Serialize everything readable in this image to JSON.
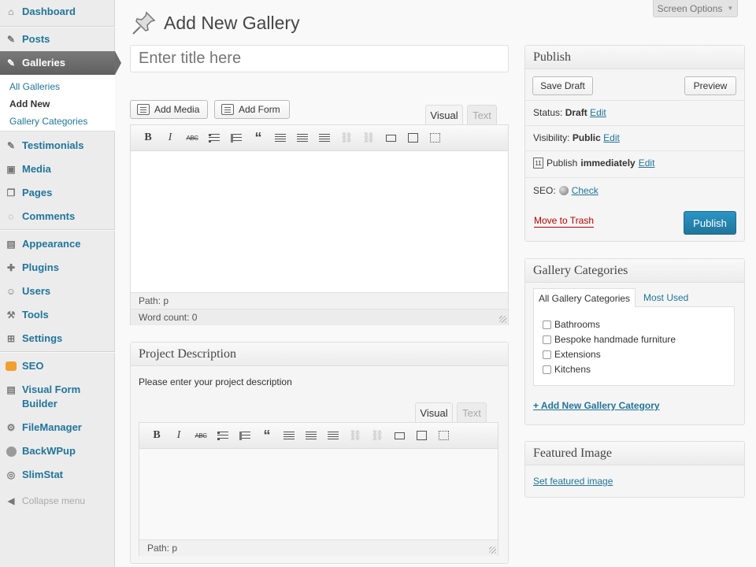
{
  "sidebar": {
    "items": [
      {
        "label": "Dashboard",
        "icon": "dashboard-icon"
      },
      {
        "label": "Posts",
        "icon": "pin-icon"
      },
      {
        "label": "Galleries",
        "icon": "pin-icon"
      },
      {
        "label": "Testimonials",
        "icon": "pin-icon"
      },
      {
        "label": "Media",
        "icon": "media-icon"
      },
      {
        "label": "Pages",
        "icon": "pages-icon"
      },
      {
        "label": "Comments",
        "icon": "comments-icon"
      },
      {
        "label": "Appearance",
        "icon": "appearance-icon"
      },
      {
        "label": "Plugins",
        "icon": "plugins-icon"
      },
      {
        "label": "Users",
        "icon": "users-icon"
      },
      {
        "label": "Tools",
        "icon": "tools-icon"
      },
      {
        "label": "Settings",
        "icon": "settings-icon"
      },
      {
        "label": "SEO",
        "icon": "seo-icon"
      },
      {
        "label": "Visual Form Builder",
        "icon": "form-icon"
      },
      {
        "label": "FileManager",
        "icon": "gear-icon"
      },
      {
        "label": "BackWPup",
        "icon": "backup-icon"
      },
      {
        "label": "SlimStat",
        "icon": "stats-icon"
      }
    ],
    "submenu": [
      "All Galleries",
      "Add New",
      "Gallery Categories"
    ],
    "collapse_label": "Collapse menu"
  },
  "screen_options": "Screen Options",
  "page_title": "Add New Gallery",
  "title_placeholder": "Enter title here",
  "editor": {
    "add_media": "Add Media",
    "add_form": "Add Form",
    "tab_visual": "Visual",
    "tab_text": "Text",
    "path": "Path: p",
    "word_count": "Word count: 0"
  },
  "project": {
    "heading": "Project Description",
    "prompt": "Please enter your project description",
    "tab_visual": "Visual",
    "tab_text": "Text",
    "path": "Path: p"
  },
  "publish": {
    "heading": "Publish",
    "save_draft": "Save Draft",
    "preview": "Preview",
    "status_label": "Status:",
    "status_value": "Draft",
    "visibility_label": "Visibility:",
    "visibility_value": "Public",
    "publish_label": "Publish",
    "publish_value": "immediately",
    "seo_label": "SEO:",
    "seo_check": "Check",
    "edit": "Edit",
    "move_to_trash": "Move to Trash",
    "publish_button": "Publish"
  },
  "categories": {
    "heading": "Gallery Categories",
    "tab_all": "All Gallery Categories",
    "tab_most_used": "Most Used",
    "items": [
      "Bathrooms",
      "Bespoke handmade furniture",
      "Extensions",
      "Kitchens"
    ],
    "add_new": "+ Add New Gallery Category"
  },
  "featured": {
    "heading": "Featured Image",
    "link": "Set featured image"
  },
  "colors": {
    "link": "#21759b",
    "publish_button": "#21759b",
    "trash": "#bb0000",
    "active_menu": "#6c6c6c"
  }
}
